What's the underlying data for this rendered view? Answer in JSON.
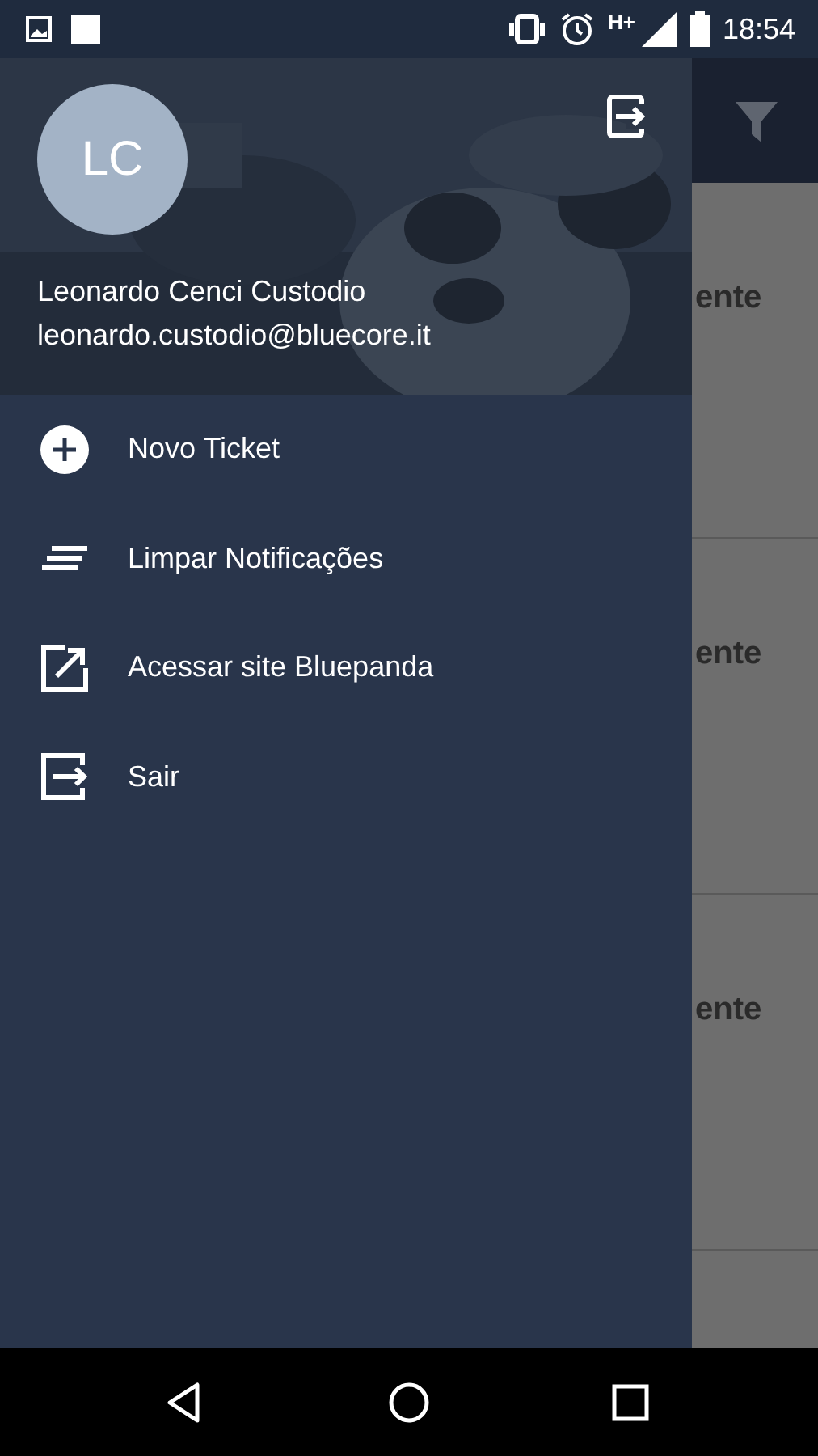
{
  "status_bar": {
    "network": "H+",
    "time": "18:54"
  },
  "drawer": {
    "header": {
      "initials": "LC",
      "name": "Leonardo Cenci Custodio",
      "email": "leonardo.custodio@bluecore.it"
    },
    "menu": [
      {
        "kind": "add",
        "label": "Novo Ticket"
      },
      {
        "kind": "clear",
        "label": "Limpar Notificações"
      },
      {
        "kind": "open",
        "label": "Acessar site Bluepanda"
      },
      {
        "kind": "exit",
        "label": "Sair"
      }
    ]
  },
  "background_list": [
    {
      "text": "ente"
    },
    {
      "text": "ente"
    },
    {
      "text": "ente"
    }
  ]
}
